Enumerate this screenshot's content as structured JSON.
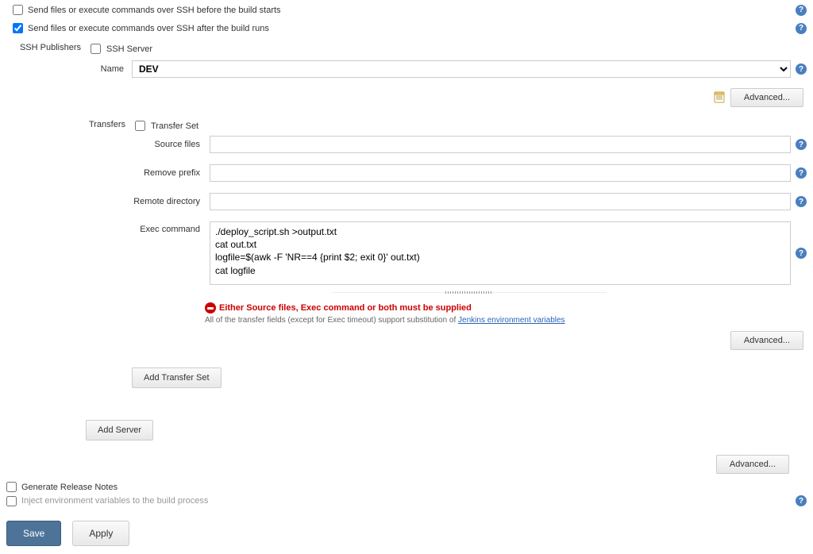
{
  "top_options": {
    "before_checked": false,
    "before_label": "Send files or execute commands over SSH before the build starts",
    "after_checked": true,
    "after_label": "Send files or execute commands over SSH after the build runs"
  },
  "ssh_publishers_label": "SSH Publishers",
  "server": {
    "section_label": "SSH Server",
    "name_label": "Name",
    "name_value": "DEV",
    "name_options": [
      "DEV"
    ],
    "advanced_button": "Advanced..."
  },
  "transfers": {
    "section_label": "Transfers",
    "set_label": "Transfer Set",
    "source_files_label": "Source files",
    "source_files_value": "",
    "remove_prefix_label": "Remove prefix",
    "remove_prefix_value": "",
    "remote_directory_label": "Remote directory",
    "remote_directory_value": "",
    "exec_command_label": "Exec command",
    "exec_command_value": "./deploy_script.sh >output.txt\ncat out.txt\nlogfile=$(awk -F 'NR==4 {print $2; exit 0}' out.txt)\ncat logfile",
    "error_text": "Either Source files, Exec command or both must be supplied",
    "hint_prefix": "All of the transfer fields (except for Exec timeout) support substitution of ",
    "hint_link_text": "Jenkins environment variables",
    "advanced_button": "Advanced...",
    "add_transfer_set_button": "Add Transfer Set"
  },
  "add_server_button": "Add Server",
  "bottom_advanced_button": "Advanced...",
  "bottom_options": {
    "generate_release_notes_checked": false,
    "generate_release_notes_label": "Generate Release Notes",
    "inject_env_checked": false,
    "inject_env_label": "Inject environment variables to the build process"
  },
  "footer": {
    "save": "Save",
    "apply": "Apply"
  }
}
